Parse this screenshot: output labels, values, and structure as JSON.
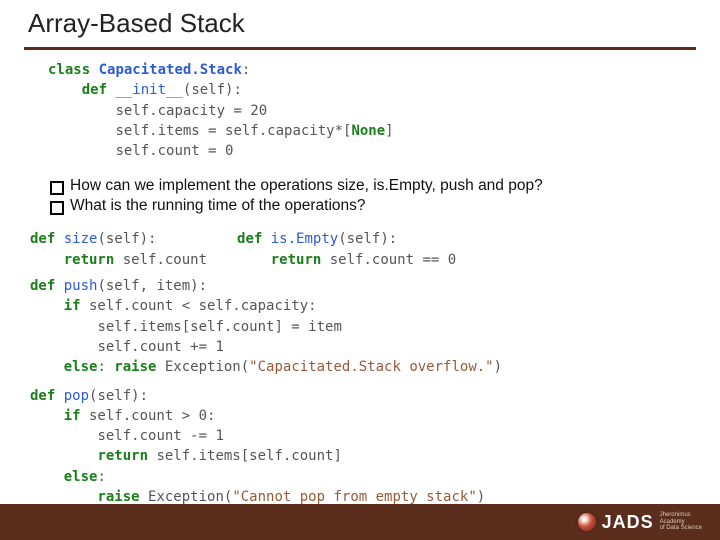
{
  "title": "Array-Based Stack",
  "code_init": {
    "l1_kw": "class",
    "l1_name": "Capacitated.Stack",
    "l1_colon": ":",
    "l2_kw": "def",
    "l2_name": "__init__",
    "l2_sig": "(self):",
    "l3": "self.capacity = 20",
    "l4a": "self.items = self.capacity*[",
    "l4_kw": "None",
    "l4b": "]",
    "l5": "self.count = 0"
  },
  "bullets": [
    "How can we implement the operations size, is.Empty, push and pop?",
    "What is the running time of the operations?"
  ],
  "code_size": {
    "l1_kw": "def",
    "l1_name": "size",
    "l1_sig": "(self):",
    "l2_kw": "return",
    "l2_rest": " self.count"
  },
  "code_isempty": {
    "l1_kw": "def",
    "l1_name": "is.Empty",
    "l1_sig": "(self):",
    "l2_kw": "return",
    "l2_rest": " self.count == 0"
  },
  "code_push": {
    "l1_kw": "def",
    "l1_name": "push",
    "l1_sig": "(self, item):",
    "l2_kw": "if",
    "l2_rest": " self.count < self.capacity:",
    "l3": "self.items[self.count] = item",
    "l4": "self.count += 1",
    "l5_kw": "else",
    "l5_colon": ": ",
    "l5_kw2": "raise",
    "l5_rest": " Exception(",
    "l5_str": "\"Capacitated.Stack overflow.\"",
    "l5_close": ")"
  },
  "code_pop": {
    "l1_kw": "def",
    "l1_name": "pop",
    "l1_sig": "(self):",
    "l2_kw": "if",
    "l2_rest": " self.count > 0:",
    "l3": "self.count -= 1",
    "l4_kw": "return",
    "l4_rest": " self.items[self.count]",
    "l5_kw": "else",
    "l5_colon": ":",
    "l6_kw": "raise",
    "l6_rest": " Exception(",
    "l6_str": "\"Cannot pop from empty stack\"",
    "l6_close": ")"
  },
  "logo": {
    "main": "JADS",
    "sub1": "Jheronimus",
    "sub2": "Academy",
    "sub3": "of Data Science"
  }
}
